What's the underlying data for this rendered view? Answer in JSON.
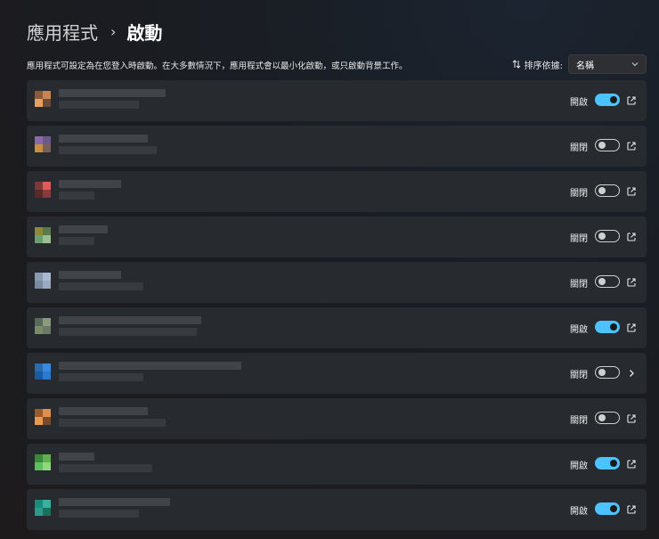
{
  "breadcrumb": {
    "parent": "應用程式",
    "separator": "›",
    "current": "啟動"
  },
  "description": "應用程式可設定為在您登入時啟動。在大多數情況下，應用程式會以最小化啟動，或只啟動背景工作。",
  "sort": {
    "label": "排序依據:",
    "value": "名稱"
  },
  "apps": [
    {
      "state": "開啟",
      "on": true,
      "action": "external-link-icon",
      "colors": [
        "#8a5a3a",
        "#c8864e",
        "#e8a060",
        "#6a4a3a"
      ],
      "w1": 120,
      "w2": 90
    },
    {
      "state": "關閉",
      "on": false,
      "action": "external-link-icon",
      "colors": [
        "#8a6aa8",
        "#6a5a8a",
        "#c89040",
        "#7a6050"
      ],
      "w1": 100,
      "w2": 110
    },
    {
      "state": "關閉",
      "on": false,
      "action": "external-link-icon",
      "colors": [
        "#7a3a3a",
        "#e05a5a",
        "#5a2a2a",
        "#8a3a3a"
      ],
      "w1": 70,
      "w2": 40
    },
    {
      "state": "關閉",
      "on": false,
      "action": "external-link-icon",
      "colors": [
        "#8a8a3a",
        "#5a7a4a",
        "#6aa070",
        "#9ac090"
      ],
      "w1": 55,
      "w2": 40
    },
    {
      "state": "關閉",
      "on": false,
      "action": "external-link-icon",
      "colors": [
        "#8a9ab0",
        "#aab8d0",
        "#7a8aa0",
        "#9aaac0"
      ],
      "w1": 70,
      "w2": 95
    },
    {
      "state": "開啟",
      "on": true,
      "action": "external-link-icon",
      "colors": [
        "#5a6a5a",
        "#8a9a7a",
        "#7a8a6a",
        "#6a7a6a"
      ],
      "w1": 160,
      "w2": 155
    },
    {
      "state": "關閉",
      "on": false,
      "action": "chevron-right-icon",
      "colors": [
        "#2a6ab0",
        "#3a8ae0",
        "#1a5aa0",
        "#2a7ad0"
      ],
      "w1": 205,
      "w2": 95
    },
    {
      "state": "關閉",
      "on": false,
      "action": "external-link-icon",
      "colors": [
        "#9a5a2a",
        "#e0904a",
        "#e89a50",
        "#7a4a2a"
      ],
      "w1": 100,
      "w2": 120
    },
    {
      "state": "開啟",
      "on": true,
      "action": "external-link-icon",
      "colors": [
        "#3a8a3a",
        "#60b050",
        "#5ac060",
        "#90d880"
      ],
      "w1": 40,
      "w2": 105
    },
    {
      "state": "開啟",
      "on": true,
      "action": "external-link-icon",
      "colors": [
        "#1a8a7a",
        "#3ab0a0",
        "#2a9a8a",
        "#1a7060"
      ],
      "w1": 125,
      "w2": 90
    }
  ]
}
